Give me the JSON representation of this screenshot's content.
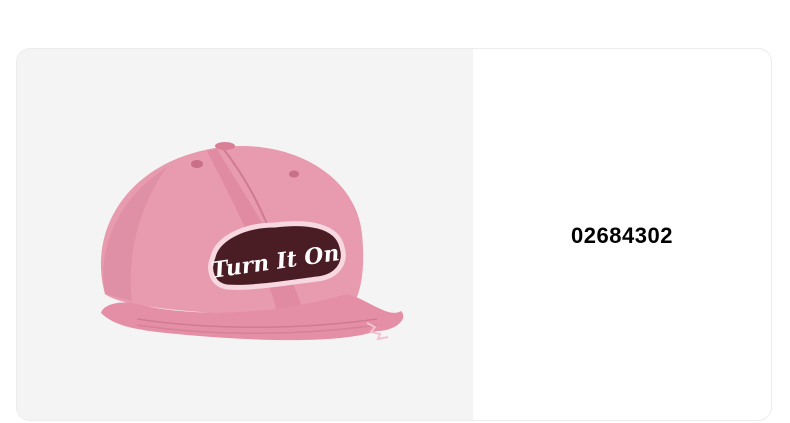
{
  "product": {
    "image": {
      "icon": "pink-baseball-cap-image",
      "embroidery_text": "Turn It On",
      "colors": {
        "cap": "#e89aae",
        "cap_shadow": "#d98097",
        "patch_outline": "#f7d7e0",
        "patch_text": "#ffffff",
        "patch_border": "#4a1c24"
      }
    },
    "code": "02684302"
  },
  "colors": {
    "image_background": "#f4f4f4",
    "card_border": "#ececec"
  }
}
